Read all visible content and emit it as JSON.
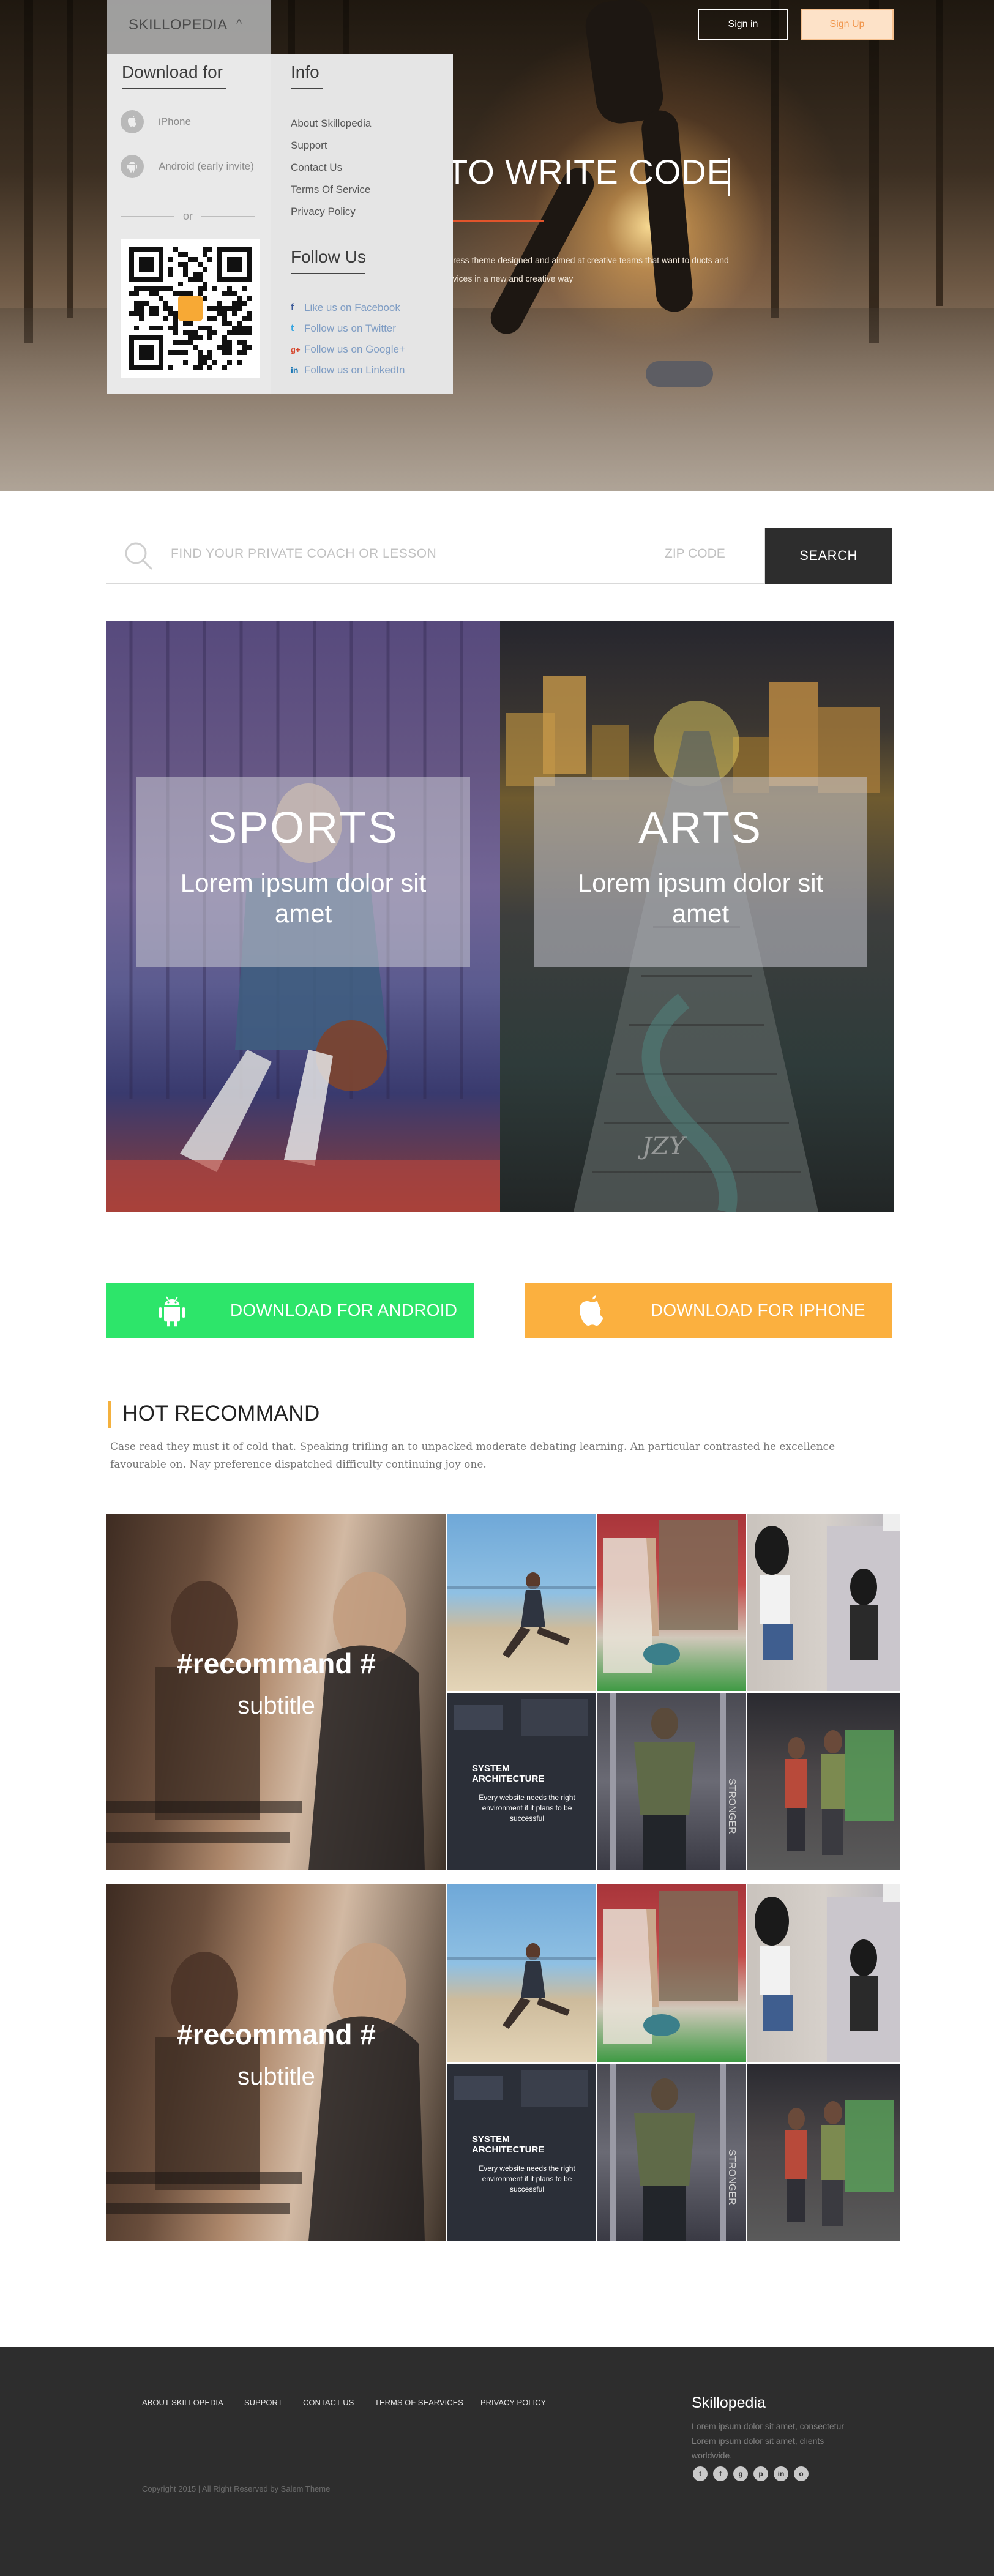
{
  "nav": {
    "brand": "SKILLOPEDIA",
    "sign_in": "Sign in",
    "sign_up": "Sign Up"
  },
  "dropdown": {
    "download_heading": "Download for",
    "iphone": "iPhone",
    "android": "Android (early invite)",
    "or": "or",
    "info_heading": "Info",
    "info_links": [
      "About Skillopedia",
      "Support",
      "Contact Us",
      "Terms Of Service",
      "Privacy Policy"
    ],
    "follow_heading": "Follow Us",
    "social": [
      "Like us on Facebook",
      "Follow us on Twitter",
      "Follow us on Google+",
      "Follow us on LinkedIn"
    ],
    "qr_label": "skillopedia"
  },
  "hero": {
    "title": "TO WRITE CODE",
    "description": "ordress theme designed and aimed at creative teams that want to ducts and services in a new and creative way"
  },
  "search": {
    "placeholder": "FIND YOUR PRIVATE COACH OR LESSON",
    "zip_placeholder": "ZIP CODE",
    "button": "SEARCH"
  },
  "categories": [
    {
      "title": "SPORTS",
      "subtitle": "Lorem ipsum dolor sit amet"
    },
    {
      "title": "ARTS",
      "subtitle": "Lorem ipsum dolor sit amet"
    }
  ],
  "arts_watermark": "JZY",
  "downloads": {
    "android": "DOWNLOAD FOR ANDROID",
    "iphone": "DOWNLOAD FOR IPHONE"
  },
  "hot": {
    "title": "HOT RECOMMAND",
    "description": "Case read they must it of cold that. Speaking trifling an to unpacked moderate debating learning. An particular contrasted he excellence favourable on. Nay preference dispatched difficulty continuing joy one."
  },
  "recommend": {
    "title": "#recommand #",
    "subtitle": "subtitle",
    "sys_title": "SYSTEM ARCHITECTURE",
    "sys_text": "Every website needs the right environment if it plans to be successful",
    "wall_text": "STRONGER"
  },
  "footer": {
    "links": [
      "ABOUT SKILLOPEDIA",
      "SUPPORT",
      "CONTACT US",
      "TERMS OF SEARVICES",
      "PRIVACY POLICY"
    ],
    "copyright": "Copyright 2015 | All Right Reserved by Salem Theme",
    "brand": "Skillopedia",
    "about": "Lorem ipsum dolor sit amet, consectetur Lorem ipsum dolor sit amet,  clients worldwide."
  },
  "colors": {
    "android_green": "#2de56a",
    "iphone_orange": "#fbb03f",
    "accent_bar": "#f4b13e",
    "dark": "#2d2d2d",
    "hero_underline": "#e2542b"
  }
}
